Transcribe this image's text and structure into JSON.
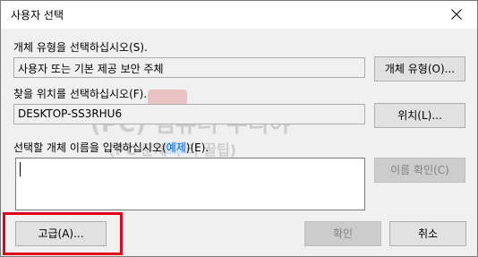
{
  "window": {
    "title": "사용자 선택"
  },
  "object_type": {
    "label": "개체 유형을 선택하십시오(S).",
    "value": "사용자 또는 기본 제공 보안 주체",
    "button": "개체 유형(O)..."
  },
  "location": {
    "label": "찾을 위치를 선택하십시오(F).",
    "value": "DESKTOP-SS3RHU6",
    "button": "위치(L)..."
  },
  "names": {
    "label_prefix": "선택할 개체 이름을 입력하십시오(",
    "label_link": "예제",
    "label_suffix": ")(E).",
    "value": "",
    "check_button": "이름 확인(C)"
  },
  "footer": {
    "advanced_button": "고급(A)...",
    "ok_button": "확인",
    "cancel_button": "취소"
  },
  "colors": {
    "highlight": "#e3001b",
    "link": "#0066cc"
  },
  "icons": {
    "close": "close-icon"
  }
}
